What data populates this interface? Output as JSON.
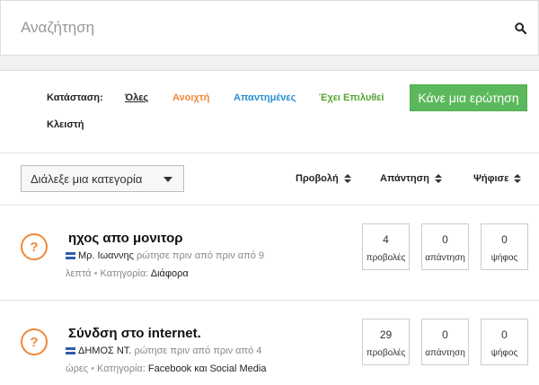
{
  "search": {
    "placeholder": "Αναζήτηση"
  },
  "filters": {
    "status_label": "Κατάσταση:",
    "all": "Όλες",
    "open": "Ανοιχτή",
    "answered": "Απαντημένες",
    "solved": "Έχει Επιλυθεί",
    "closed": "Κλειστή",
    "colors": {
      "open": "#f0883a",
      "answered": "#2a8fd0",
      "solved": "#56a432",
      "ask_button": "#5cb85c"
    }
  },
  "ask_button": "Κάνε μια ερώτηση",
  "sortbar": {
    "category_select": "Διάλεξε μια κατεγορία",
    "views": "Προβολή",
    "answers": "Απάντηση",
    "votes": "Ψήφισε"
  },
  "questions": [
    {
      "icon": "question-icon",
      "title": "ηχος απο μονιτορ",
      "user": "Μρ. Ιωαννης",
      "meta_line1": "ρώτησε πριν από πριν από 9",
      "meta_time2": "λεπτά",
      "category_label": "Κατηγορία:",
      "category": "Διάφορα",
      "views": "4",
      "views_label": "προβολές",
      "answers": "0",
      "answers_label": "απάντηση",
      "votes": "0",
      "votes_label": "ψήφος"
    },
    {
      "icon": "question-icon",
      "title": "Σύνδση στο internet.",
      "user": "ΔΗΜΟΣ ΝΤ.",
      "meta_line1": "ρώτησε πριν από πριν από 4",
      "meta_time2": "ώρες",
      "category_label": "Κατηγορία:",
      "category": "Facebook και Social Media",
      "views": "29",
      "views_label": "προβολές",
      "answers": "0",
      "answers_label": "απάντηση",
      "votes": "0",
      "votes_label": "ψήφος"
    }
  ],
  "separator": "•"
}
